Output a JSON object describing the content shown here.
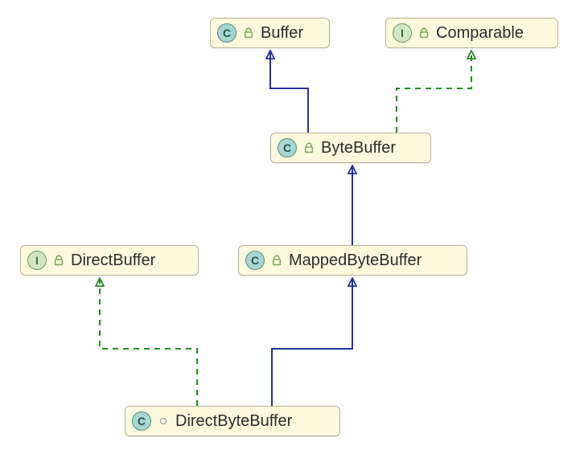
{
  "diagram": {
    "nodes": {
      "buffer": {
        "label": "Buffer",
        "kind": "class",
        "visibility": "public"
      },
      "comparable": {
        "label": "Comparable",
        "kind": "interface",
        "visibility": "public"
      },
      "bytebuffer": {
        "label": "ByteBuffer",
        "kind": "class",
        "visibility": "public"
      },
      "mappedbytebuffer": {
        "label": "MappedByteBuffer",
        "kind": "class",
        "visibility": "public"
      },
      "directbuffer": {
        "label": "DirectBuffer",
        "kind": "interface",
        "visibility": "public"
      },
      "directbytebuffer": {
        "label": "DirectByteBuffer",
        "kind": "class",
        "visibility": "package"
      }
    },
    "edges": [
      {
        "from": "bytebuffer",
        "to": "buffer",
        "relation": "extends"
      },
      {
        "from": "bytebuffer",
        "to": "comparable",
        "relation": "implements"
      },
      {
        "from": "mappedbytebuffer",
        "to": "bytebuffer",
        "relation": "extends"
      },
      {
        "from": "directbytebuffer",
        "to": "mappedbytebuffer",
        "relation": "extends"
      },
      {
        "from": "directbytebuffer",
        "to": "directbuffer",
        "relation": "implements"
      }
    ],
    "style": {
      "extendsColor": "#24309c",
      "implementsColor": "#228b22",
      "nodeFill": "#fcfadc",
      "nodeBorder": "#b8b093"
    },
    "badge": {
      "classLetter": "C",
      "interfaceLetter": "I"
    }
  }
}
